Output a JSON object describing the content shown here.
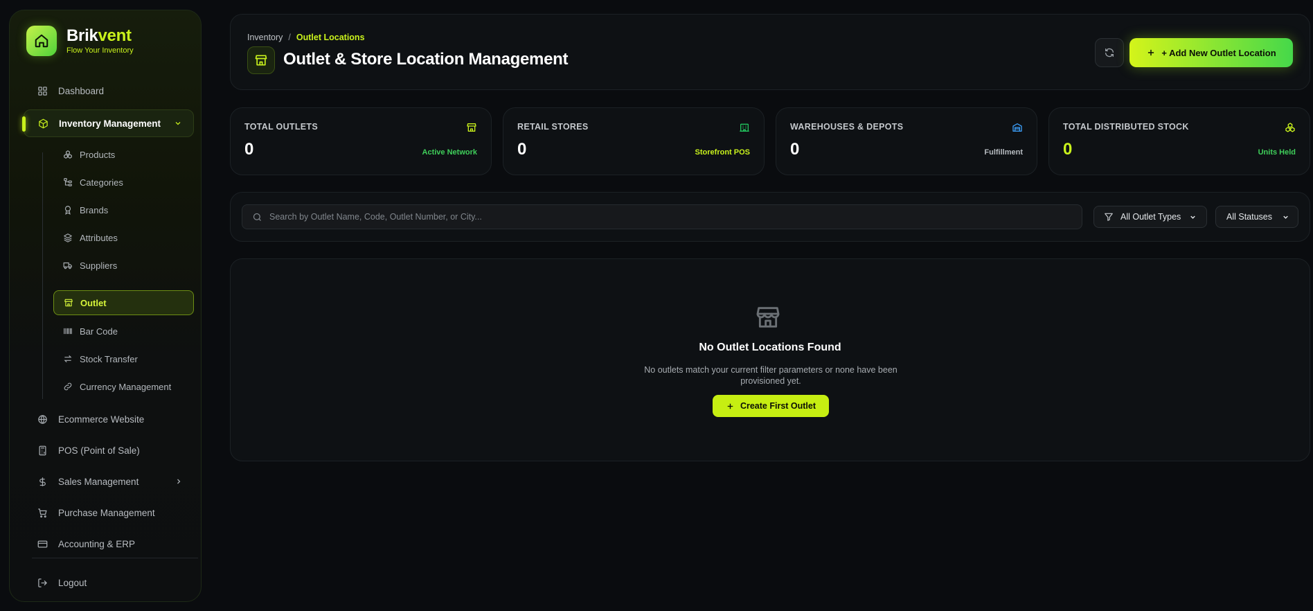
{
  "brand": {
    "name_main": "Brik",
    "name_accent": "vent",
    "tagline": "Flow Your Inventory"
  },
  "sidebar": {
    "dashboard": "Dashboard",
    "inventory_management": "Inventory Management",
    "sub_items": [
      "Products",
      "Categories",
      "Brands",
      "Attributes",
      "Suppliers",
      "Outlet",
      "Bar Code",
      "Stock Transfer",
      "Currency Management"
    ],
    "ecommerce": "Ecommerce Website",
    "pos": "POS (Point of Sale)",
    "sales": "Sales Management",
    "purchase": "Purchase Management",
    "accounting": "Accounting & ERP",
    "logout": "Logout"
  },
  "header": {
    "breadcrumb_root": "Inventory",
    "breadcrumb_sep": "/",
    "breadcrumb_current": "Outlet Locations",
    "title": "Outlet & Store Location Management",
    "add_button": "+ Add New Outlet Location"
  },
  "stats": [
    {
      "label": "TOTAL OUTLETS",
      "value": "0",
      "note": "Active Network",
      "note_color": "#3fcf5a",
      "icon": "store-icon",
      "icon_color": "#c9f21c"
    },
    {
      "label": "RETAIL STORES",
      "value": "0",
      "note": "Storefront POS",
      "note_color": "#c9f21c",
      "icon": "building-icon",
      "icon_color": "#22c55e"
    },
    {
      "label": "WAREHOUSES & DEPOTS",
      "value": "0",
      "note": "Fulfillment",
      "note_color": "#b6bbc0",
      "icon": "warehouse-icon",
      "icon_color": "#3b9cf5"
    },
    {
      "label": "TOTAL DISTRIBUTED STOCK",
      "value": "0",
      "note": "Units Held",
      "note_color": "#3fcf5a",
      "icon": "boxes-icon",
      "icon_color": "#c9f21c"
    }
  ],
  "filters": {
    "search_placeholder": "Search by Outlet Name, Code, Outlet Number, or City...",
    "type_select": "All Outlet Types",
    "status_select": "All Statuses"
  },
  "empty": {
    "title": "No Outlet Locations Found",
    "description": "No outlets match your current filter parameters or none have been provisioned yet.",
    "button": "Create First Outlet"
  }
}
